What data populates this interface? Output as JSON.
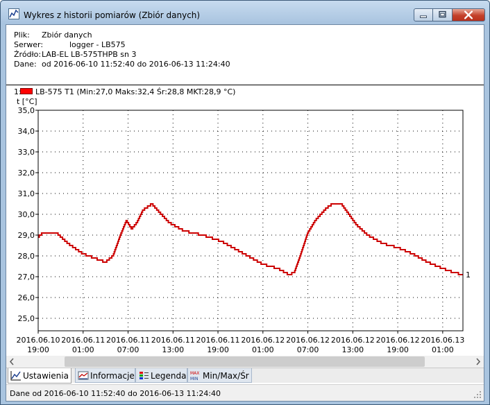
{
  "window": {
    "title": "Wykres z historii pomiarów (Zbiór danych)"
  },
  "info": {
    "file_label": "Plik:",
    "file_value": "Zbiór danych",
    "server_label": "Serwer:",
    "server_value": "logger - LB575",
    "source_label": "Źródło:",
    "source_value": "LAB-EL LB-575THPB sn 3",
    "data_label": "Dane:",
    "data_value": "od 2016-06-10 11:52:40 do 2016-06-13 11:24:40"
  },
  "legend": {
    "index": "1:",
    "text": "LB-575 T1 (Min:27,0 Maks:32,4 Śr:28,8 MKT:28,9 °C)",
    "color": "#ff0000"
  },
  "tabs": [
    {
      "label": "Ustawienia",
      "icon": "chart-line-icon"
    },
    {
      "label": "Informacje",
      "icon": "info-chart-icon"
    },
    {
      "label": "Legenda",
      "icon": "legend-icon"
    },
    {
      "label": "Min/Max/Śr",
      "icon": "min-max-icon"
    }
  ],
  "status": {
    "text": "Dane od 2016-06-10 11:52:40 do 2016-06-13 11:24:40"
  },
  "chart_data": {
    "type": "line",
    "title": "",
    "ylabel": "t [°C]",
    "xlabel": "",
    "ylim": [
      24.4,
      35.0
    ],
    "y_ticks": [
      "35,0",
      "34,0",
      "33,0",
      "32,0",
      "31,0",
      "30,0",
      "29,0",
      "28,0",
      "27,0",
      "26,0",
      "25,0"
    ],
    "y_tick_values": [
      35,
      34,
      33,
      32,
      31,
      30,
      29,
      28,
      27,
      26,
      25
    ],
    "x_range_hours": [
      0,
      56.7
    ],
    "x_ticks": [
      {
        "date": "2016.06.10",
        "time": "19:00",
        "hours": 0
      },
      {
        "date": "2016.06.11",
        "time": "01:00",
        "hours": 6
      },
      {
        "date": "2016.06.11",
        "time": "07:00",
        "hours": 12
      },
      {
        "date": "2016.06.11",
        "time": "13:00",
        "hours": 18
      },
      {
        "date": "2016.06.11",
        "time": "19:00",
        "hours": 24
      },
      {
        "date": "2016.06.12",
        "time": "01:00",
        "hours": 30
      },
      {
        "date": "2016.06.12",
        "time": "07:00",
        "hours": 36
      },
      {
        "date": "2016.06.12",
        "time": "13:00",
        "hours": 42
      },
      {
        "date": "2016.06.12",
        "time": "19:00",
        "hours": 48
      },
      {
        "date": "2016.06.13",
        "time": "01:00",
        "hours": 54
      }
    ],
    "grid": true,
    "series": [
      {
        "name": "LB-575 T1",
        "end_label": "1",
        "color": "#cc0000",
        "points": [
          [
            0,
            28.9
          ],
          [
            0.6,
            29.1
          ],
          [
            2.5,
            29.1
          ],
          [
            4.0,
            28.6
          ],
          [
            6.0,
            28.1
          ],
          [
            7.5,
            27.9
          ],
          [
            9.0,
            27.7
          ],
          [
            10.0,
            28.0
          ],
          [
            11.0,
            29.0
          ],
          [
            11.8,
            29.7
          ],
          [
            12.5,
            29.3
          ],
          [
            13.2,
            29.6
          ],
          [
            14.0,
            30.2
          ],
          [
            15.2,
            30.5
          ],
          [
            16.2,
            30.1
          ],
          [
            17.5,
            29.6
          ],
          [
            19.5,
            29.2
          ],
          [
            22.0,
            29.0
          ],
          [
            24.5,
            28.7
          ],
          [
            26.0,
            28.4
          ],
          [
            28.0,
            28.0
          ],
          [
            30.0,
            27.6
          ],
          [
            32.0,
            27.4
          ],
          [
            33.5,
            27.1
          ],
          [
            34.2,
            27.2
          ],
          [
            35.0,
            28.0
          ],
          [
            36.0,
            29.1
          ],
          [
            37.0,
            29.7
          ],
          [
            38.5,
            30.3
          ],
          [
            39.3,
            30.5
          ],
          [
            40.5,
            30.5
          ],
          [
            41.5,
            30.0
          ],
          [
            42.5,
            29.5
          ],
          [
            44.0,
            29.0
          ],
          [
            46.0,
            28.6
          ],
          [
            48.0,
            28.4
          ],
          [
            50.0,
            28.1
          ],
          [
            52.0,
            27.7
          ],
          [
            54.0,
            27.4
          ],
          [
            55.5,
            27.2
          ],
          [
            56.7,
            27.1
          ]
        ]
      }
    ]
  }
}
